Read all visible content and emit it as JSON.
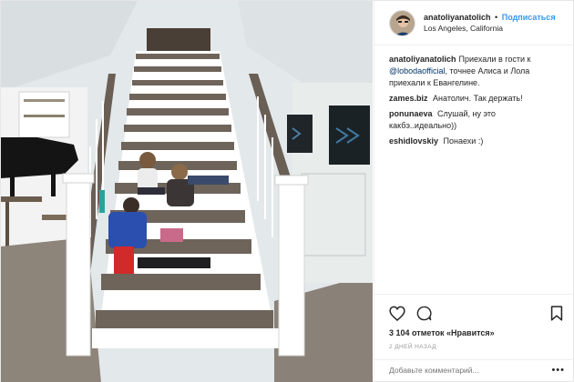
{
  "post": {
    "author": "anatoliyanatolich",
    "follow_label": "Подписаться",
    "dot": "•",
    "location": "Los Angeles, California",
    "caption": {
      "user": "anatoliyanatolich",
      "text_before": "Приехали в гости к ",
      "mention": "@lobodaofficial",
      "text_after": ", точнее Алиса и Лола приехали к Евангелине."
    },
    "comments": [
      {
        "user": "zames.biz",
        "text": "Анатолич. Так держать!"
      },
      {
        "user": "ponunaeva",
        "text": "Слушай, ну это какбэ..идеально))"
      },
      {
        "user": "eshidlovskiy",
        "text": "Понаехи :)"
      }
    ],
    "likes": "3 104 отметок «Нравится»",
    "time": "2 ДНЕЙ НАЗАД",
    "add_comment_placeholder": "Добавьте комментарий...",
    "more_dots": "•••"
  },
  "colors": {
    "link": "#3897f0",
    "text": "#262626",
    "muted": "#999999"
  },
  "icons": [
    "heart-icon",
    "comment-icon",
    "bookmark-icon",
    "more-icon"
  ]
}
